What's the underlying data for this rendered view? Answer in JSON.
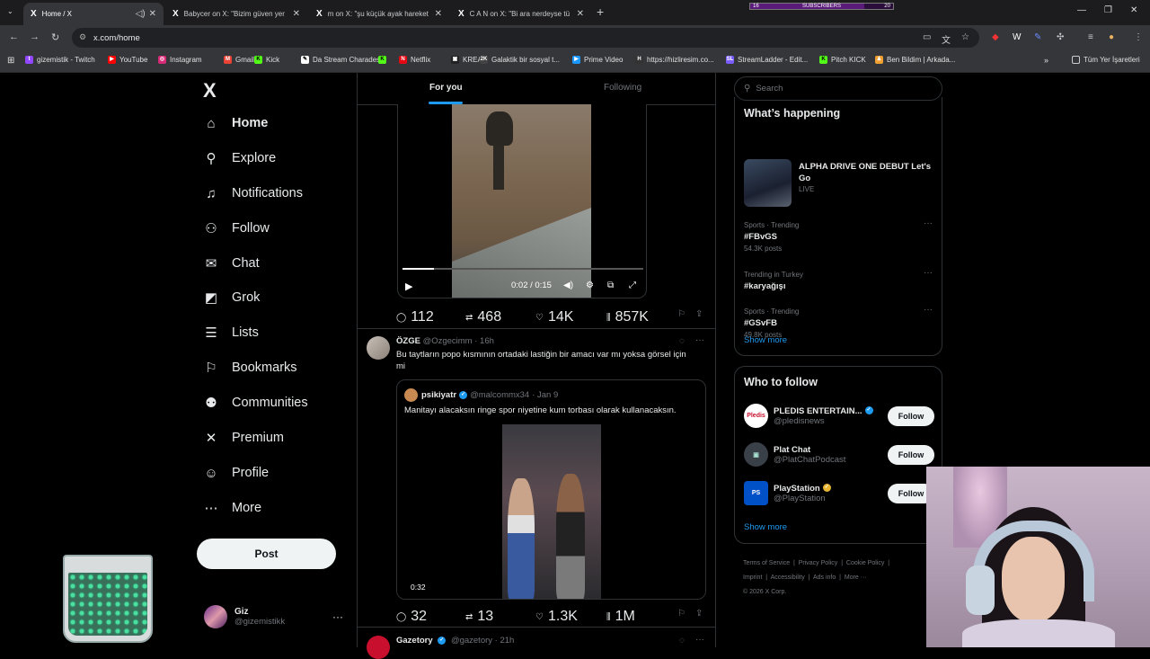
{
  "browser": {
    "tabs": [
      {
        "icon": "X",
        "title": "Home / X",
        "active": true
      },
      {
        "icon": "X",
        "title": "Babycer on X: \"Bizim güven yer",
        "active": false
      },
      {
        "icon": "X",
        "title": "m on X: \"şu küçük ayak hareket",
        "active": false
      },
      {
        "icon": "X",
        "title": "C A N on X: \"Bi ara nerdeyse tü",
        "active": false
      }
    ],
    "subscribers": {
      "left": "16",
      "label": "SUBSCRIBERS",
      "right": "20",
      "progress": 0.8
    },
    "url": "x.com/home",
    "bookmarks": [
      {
        "label": "gizemistik - Twitch",
        "color": "#9146ff",
        "glyph": "t"
      },
      {
        "label": "YouTube",
        "color": "#ff0000",
        "glyph": "▶"
      },
      {
        "label": "Instagram",
        "color": "#d62976",
        "glyph": "◎"
      },
      {
        "label": "Gmail",
        "color": "#ea4335",
        "glyph": "M"
      },
      {
        "label": "Kick",
        "color": "#53fc18",
        "glyph": "K"
      },
      {
        "label": "Da Stream Charades",
        "color": "#ffffff",
        "glyph": "✎"
      },
      {
        "label": "",
        "color": "#53fc18",
        "glyph": "K"
      },
      {
        "label": "Netflix",
        "color": "#e50914",
        "glyph": "N"
      },
      {
        "label": "KREA",
        "color": "#222222",
        "glyph": "▣"
      },
      {
        "label": "Galaktik bir sosyal t...",
        "color": "#444444",
        "glyph": "2K"
      },
      {
        "label": "Prime Video",
        "color": "#1a98ff",
        "glyph": "▶"
      },
      {
        "label": "https://hizliresim.co...",
        "color": "#333333",
        "glyph": "H"
      },
      {
        "label": "StreamLadder - Edit...",
        "color": "#7b5cff",
        "glyph": "SL"
      },
      {
        "label": "Pitch KICK",
        "color": "#53fc18",
        "glyph": "K"
      },
      {
        "label": "Ben Bildim | Arkada...",
        "color": "#f0a030",
        "glyph": "♟"
      }
    ],
    "all_bookmarks": "Tüm Yer İşaretleri"
  },
  "sidebar": {
    "logo": "X",
    "items": [
      {
        "label": "Home",
        "icon": "home-icon",
        "glyph": "⌂"
      },
      {
        "label": "Explore",
        "icon": "search-icon",
        "glyph": "⚲"
      },
      {
        "label": "Notifications",
        "icon": "bell-icon",
        "glyph": "♫"
      },
      {
        "label": "Follow",
        "icon": "add-person-icon",
        "glyph": "⚇"
      },
      {
        "label": "Chat",
        "icon": "mail-icon",
        "glyph": "✉"
      },
      {
        "label": "Grok",
        "icon": "grok-icon",
        "glyph": "◩"
      },
      {
        "label": "Lists",
        "icon": "list-icon",
        "glyph": "☰"
      },
      {
        "label": "Bookmarks",
        "icon": "bookmark-icon",
        "glyph": "⚐"
      },
      {
        "label": "Communities",
        "icon": "people-icon",
        "glyph": "⚉"
      },
      {
        "label": "Premium",
        "icon": "x-premium-icon",
        "glyph": "✕"
      },
      {
        "label": "Profile",
        "icon": "person-icon",
        "glyph": "☺"
      },
      {
        "label": "More",
        "icon": "more-circle-icon",
        "glyph": "⋯"
      }
    ],
    "post_button": "Post",
    "account": {
      "name": "Giz",
      "handle": "@gizemistikk"
    }
  },
  "feed": {
    "tabs": [
      "For you",
      "Following"
    ],
    "video_post": {
      "time": "0:02 / 0:15",
      "progress": 0.13,
      "stats": {
        "replies": "112",
        "reposts": "468",
        "likes": "14K",
        "views": "857K"
      }
    },
    "tweet": {
      "name": "ÖZGE",
      "handle": "@Ozgecimm",
      "time": "· 16h",
      "text": "Bu taytların popo kısmının ortadaki lastiğin bir amacı var mı yoksa görsel için mi",
      "quote": {
        "name": "psikiyatr",
        "handle": "@malcommx34",
        "time": "· Jan 9",
        "text": "Manitayı alacaksın ringe spor niyetine kum torbası olarak kullanacaksın.",
        "duration": "0:32"
      },
      "stats": {
        "replies": "32",
        "reposts": "13",
        "likes": "1.3K",
        "views": "1M"
      }
    },
    "next_tweet": {
      "name": "Gazetory",
      "handle": "@gazetory",
      "time": "· 21h"
    }
  },
  "right": {
    "search_placeholder": "Search",
    "whats_happening": {
      "title": "What’s happening",
      "featured": {
        "title": "ALPHA DRIVE ONE DEBUT Let's Go",
        "status": "LIVE"
      },
      "trends": [
        {
          "category": "Sports · Trending",
          "topic": "#FBvGS",
          "posts": "54.3K posts"
        },
        {
          "category": "Trending in Turkey",
          "topic": "#karyağışı",
          "posts": ""
        },
        {
          "category": "Sports · Trending",
          "topic": "#GSvFB",
          "posts": "49.8K posts"
        }
      ],
      "show_more": "Show more"
    },
    "who_to_follow": {
      "title": "Who to follow",
      "accounts": [
        {
          "name": "PLEDIS ENTERTAIN...",
          "handle": "@pledisnews",
          "button": "Follow"
        },
        {
          "name": "Plat Chat",
          "handle": "@PlatChatPodcast",
          "button": "Follow"
        },
        {
          "name": "PlayStation",
          "handle": "@PlayStation",
          "button": "Follow"
        }
      ],
      "show_more": "Show more"
    },
    "footer": {
      "links": [
        "Terms of Service",
        "Privacy Policy",
        "Cookie Policy",
        "Imprint",
        "Accessibility",
        "Ads info",
        "More ···"
      ],
      "copyright": "© 2026 X Corp."
    }
  }
}
